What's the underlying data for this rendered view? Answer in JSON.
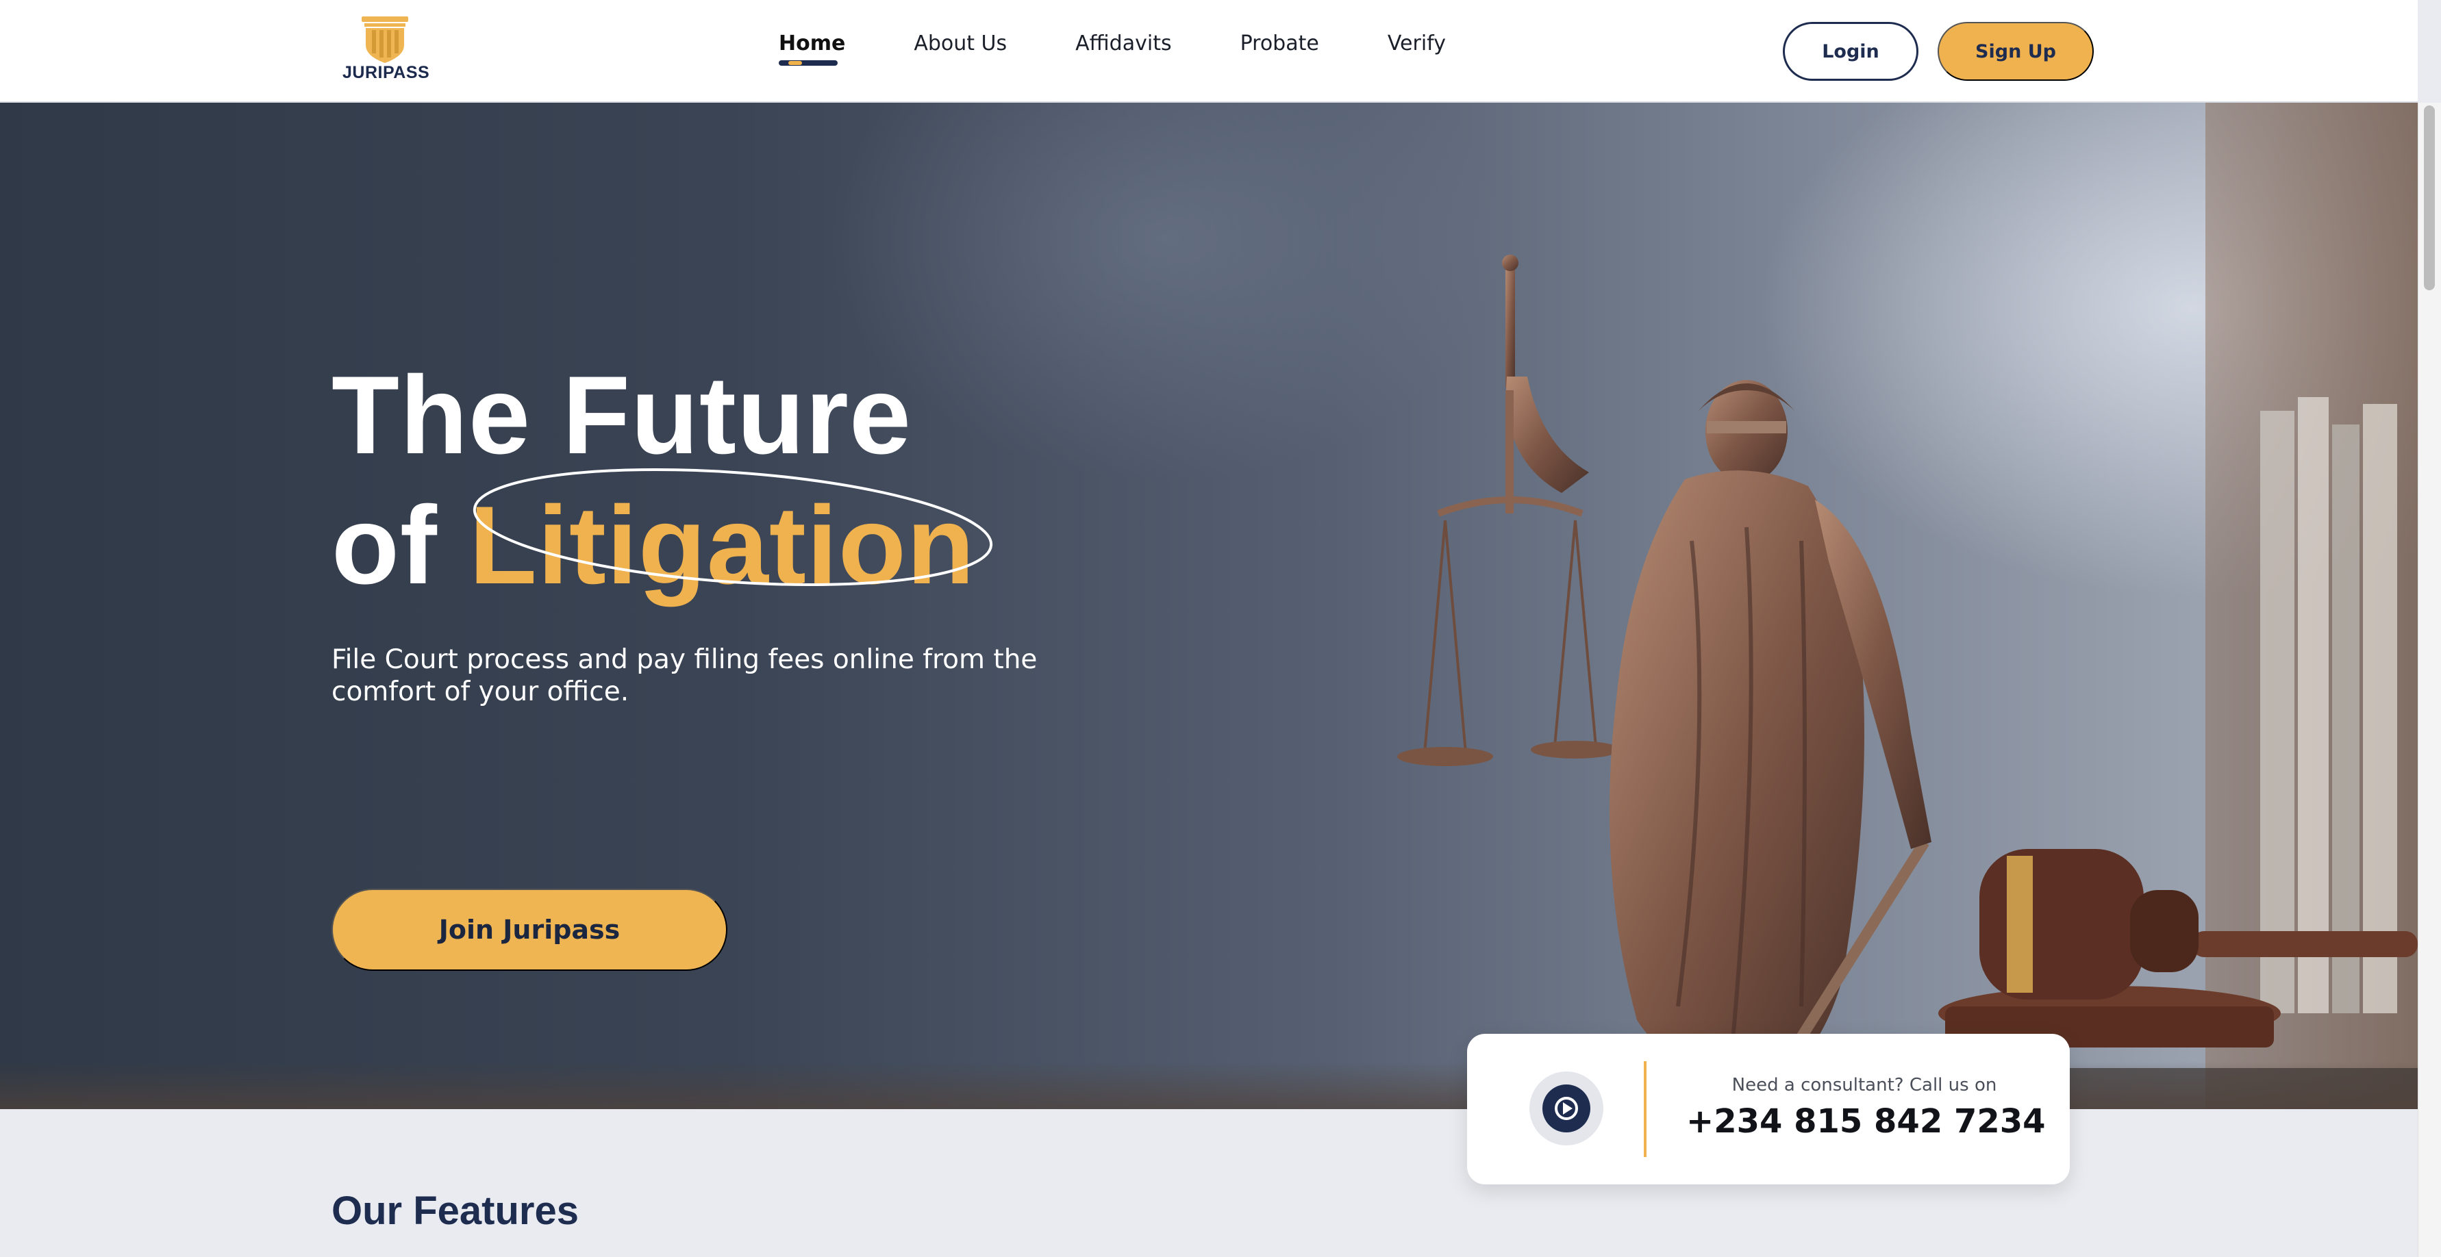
{
  "brand": {
    "name": "JURIPASS",
    "colors": {
      "navy": "#1e2c4f",
      "gold": "#f0b24f"
    }
  },
  "nav": {
    "links": [
      {
        "label": "Home",
        "active": true
      },
      {
        "label": "About Us"
      },
      {
        "label": "Affidavits"
      },
      {
        "label": "Probate"
      },
      {
        "label": "Verify"
      }
    ],
    "login_label": "Login",
    "signup_label": "Sign Up"
  },
  "hero": {
    "title_line1": "The Future",
    "title_line2_prefix": "of",
    "title_line2_accent": "Litigation",
    "subtitle": "File Court process and pay filing fees online from the comfort of your office.",
    "cta_label": "Join Juripass"
  },
  "consult": {
    "label": "Need a consultant? Call us on",
    "phone": "+234 815 842 7234",
    "icon": "play-icon"
  },
  "features": {
    "title": "Our Features"
  }
}
